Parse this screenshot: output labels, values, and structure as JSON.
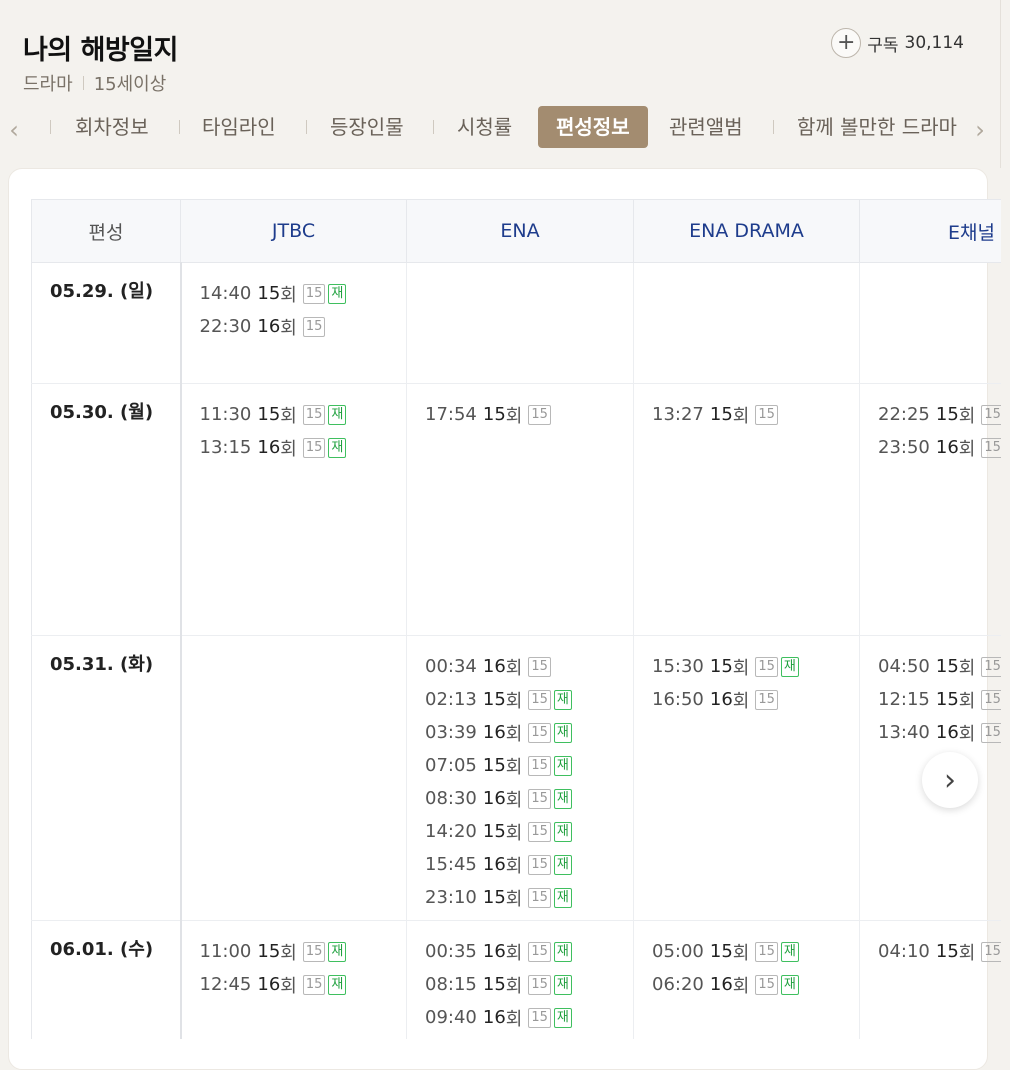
{
  "program": {
    "title": "나의 해방일지",
    "genre": "드라마",
    "rating": "15세이상",
    "subscribe_icon": "+",
    "subscribe_label": "구독",
    "subscribe_count": "30,114"
  },
  "tabs": [
    {
      "label": "회차정보"
    },
    {
      "label": "타임라인"
    },
    {
      "label": "등장인물"
    },
    {
      "label": "시청률"
    },
    {
      "label": "편성정보"
    },
    {
      "label": "관련앨범"
    },
    {
      "label": "함께 볼만한 드라마"
    }
  ],
  "icons": {
    "prev": "chevron-left-icon",
    "next": "chevron-right-icon",
    "subscribe": "plus-circle-icon"
  },
  "schedule": {
    "corner_label": "편성",
    "channels": [
      "JTBC",
      "ENA",
      "ENA DRAMA",
      "E채널"
    ],
    "badges": {
      "age": "15",
      "rerun": "재"
    },
    "rows": [
      {
        "date": "05.29. (일)",
        "cells": [
          [
            {
              "time": "14:40",
              "ep": "15",
              "unit": "회",
              "rerun": true
            },
            {
              "time": "22:30",
              "ep": "16",
              "unit": "회",
              "rerun": false
            }
          ],
          [],
          [],
          []
        ]
      },
      {
        "date": "05.30. (월)",
        "cells": [
          [
            {
              "time": "11:30",
              "ep": "15",
              "unit": "회",
              "rerun": true
            },
            {
              "time": "13:15",
              "ep": "16",
              "unit": "회",
              "rerun": true
            }
          ],
          [
            {
              "time": "17:54",
              "ep": "15",
              "unit": "회",
              "rerun": false
            }
          ],
          [
            {
              "time": "13:27",
              "ep": "15",
              "unit": "회",
              "rerun": false
            }
          ],
          [
            {
              "time": "22:25",
              "ep": "15",
              "unit": "회",
              "rerun": false
            },
            {
              "time": "23:50",
              "ep": "16",
              "unit": "회",
              "rerun": false
            }
          ]
        ]
      },
      {
        "date": "05.31. (화)",
        "cells": [
          [],
          [
            {
              "time": "00:34",
              "ep": "16",
              "unit": "회",
              "rerun": false
            },
            {
              "time": "02:13",
              "ep": "15",
              "unit": "회",
              "rerun": true
            },
            {
              "time": "03:39",
              "ep": "16",
              "unit": "회",
              "rerun": true
            },
            {
              "time": "07:05",
              "ep": "15",
              "unit": "회",
              "rerun": true
            },
            {
              "time": "08:30",
              "ep": "16",
              "unit": "회",
              "rerun": true
            },
            {
              "time": "14:20",
              "ep": "15",
              "unit": "회",
              "rerun": true
            },
            {
              "time": "15:45",
              "ep": "16",
              "unit": "회",
              "rerun": true
            },
            {
              "time": "23:10",
              "ep": "15",
              "unit": "회",
              "rerun": true
            }
          ],
          [
            {
              "time": "15:30",
              "ep": "15",
              "unit": "회",
              "rerun": true
            },
            {
              "time": "16:50",
              "ep": "16",
              "unit": "회",
              "rerun": false
            }
          ],
          [
            {
              "time": "04:50",
              "ep": "15",
              "unit": "회",
              "rerun": false
            },
            {
              "time": "12:15",
              "ep": "15",
              "unit": "회",
              "rerun": false
            },
            {
              "time": "13:40",
              "ep": "16",
              "unit": "회",
              "rerun": false
            }
          ]
        ]
      },
      {
        "date": "06.01. (수)",
        "cells": [
          [
            {
              "time": "11:00",
              "ep": "15",
              "unit": "회",
              "rerun": true
            },
            {
              "time": "12:45",
              "ep": "16",
              "unit": "회",
              "rerun": true
            }
          ],
          [
            {
              "time": "00:35",
              "ep": "16",
              "unit": "회",
              "rerun": true
            },
            {
              "time": "08:15",
              "ep": "15",
              "unit": "회",
              "rerun": true
            },
            {
              "time": "09:40",
              "ep": "16",
              "unit": "회",
              "rerun": true
            }
          ],
          [
            {
              "time": "05:00",
              "ep": "15",
              "unit": "회",
              "rerun": true
            },
            {
              "time": "06:20",
              "ep": "16",
              "unit": "회",
              "rerun": true
            }
          ],
          [
            {
              "time": "04:10",
              "ep": "15",
              "unit": "회",
              "rerun": false
            }
          ]
        ]
      }
    ]
  }
}
